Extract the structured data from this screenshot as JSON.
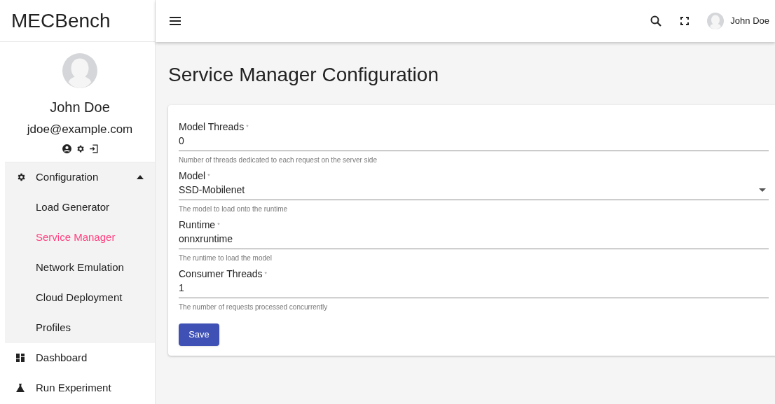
{
  "sidebar": {
    "brand": "MECBench",
    "user": {
      "name": "John Doe",
      "email": "jdoe@example.com"
    },
    "nav": [
      {
        "label": "Configuration",
        "expanded": true,
        "children": [
          {
            "label": "Load Generator",
            "selected": false
          },
          {
            "label": "Service Manager",
            "selected": true
          },
          {
            "label": "Network Emulation",
            "selected": false
          },
          {
            "label": "Cloud Deployment",
            "selected": false
          },
          {
            "label": "Profiles",
            "selected": false
          }
        ]
      },
      {
        "label": "Dashboard",
        "expanded": false
      },
      {
        "label": "Run Experiment",
        "expanded": false
      }
    ]
  },
  "header": {
    "user_name": "John Doe"
  },
  "page": {
    "title": "Service Manager Configuration",
    "fields": [
      {
        "kind": "text",
        "label": "Model Threads",
        "required_mark": "*",
        "value": "0",
        "helper": "Number of threads dedicated to each request on the server side"
      },
      {
        "kind": "select",
        "label": "Model",
        "required_mark": "*",
        "value": "SSD-Mobilenet",
        "helper": "The model to load onto the runtime"
      },
      {
        "kind": "text",
        "label": "Runtime",
        "required_mark": "*",
        "value": "onnxruntime",
        "helper": "The runtime to load the model"
      },
      {
        "kind": "text",
        "label": "Consumer Threads",
        "required_mark": "*",
        "value": "1",
        "helper": "The number of requests processed concurrently"
      }
    ],
    "save_button": "Save"
  }
}
